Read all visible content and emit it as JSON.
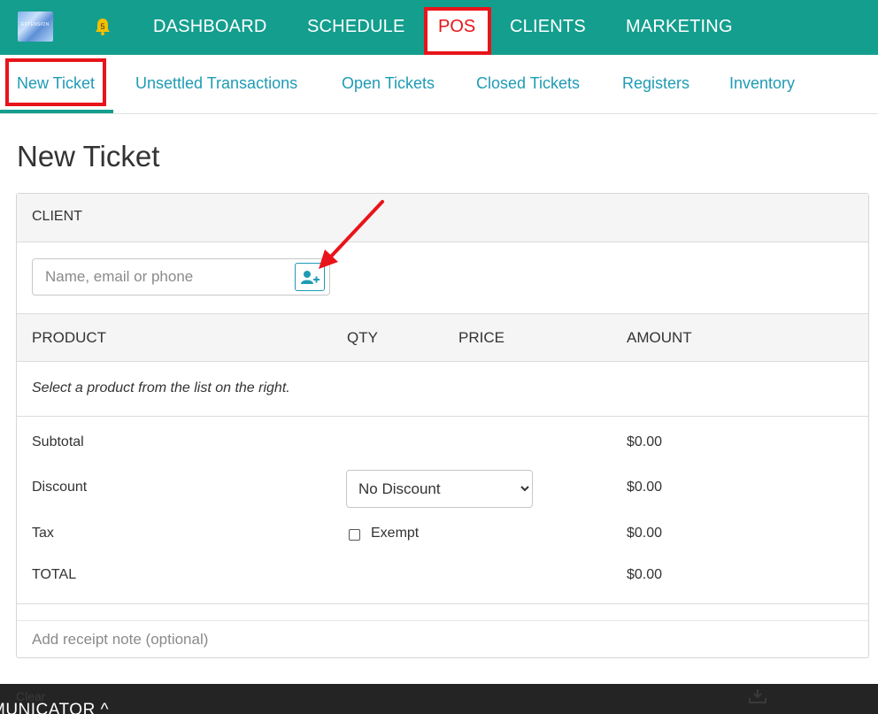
{
  "topnav": {
    "logo_text": "EXTENSION",
    "notification_count": "5",
    "items": [
      "DASHBOARD",
      "SCHEDULE",
      "POS",
      "CLIENTS",
      "MARKETING"
    ],
    "active_item": "POS",
    "background_color": "#149e8e",
    "highlight_color": "#e8141a"
  },
  "subnav": {
    "items": [
      "New Ticket",
      "Unsettled Transactions",
      "Open Tickets",
      "Closed Tickets",
      "Registers",
      "Inventory"
    ],
    "active_item": "New Ticket",
    "link_color": "#1f9bb4"
  },
  "page": {
    "title": "New Ticket"
  },
  "ticket": {
    "client_header": "CLIENT",
    "client_placeholder": "Name, email or phone",
    "columns": [
      "PRODUCT",
      "QTY",
      "PRICE",
      "AMOUNT"
    ],
    "empty_message": "Select a product from the list on the right.",
    "summary": {
      "subtotal_label": "Subtotal",
      "subtotal_value": "$0.00",
      "discount_label": "Discount",
      "discount_selected": "No Discount",
      "discount_value": "$0.00",
      "tax_label": "Tax",
      "tax_exempt_label": "Exempt",
      "tax_value": "$0.00",
      "total_label": "TOTAL",
      "total_value": "$0.00"
    },
    "receipt_note_placeholder": "Add receipt note (optional)"
  },
  "bottombar": {
    "clear_label": "Clear",
    "communicator_label": "MUNICATOR ^"
  }
}
